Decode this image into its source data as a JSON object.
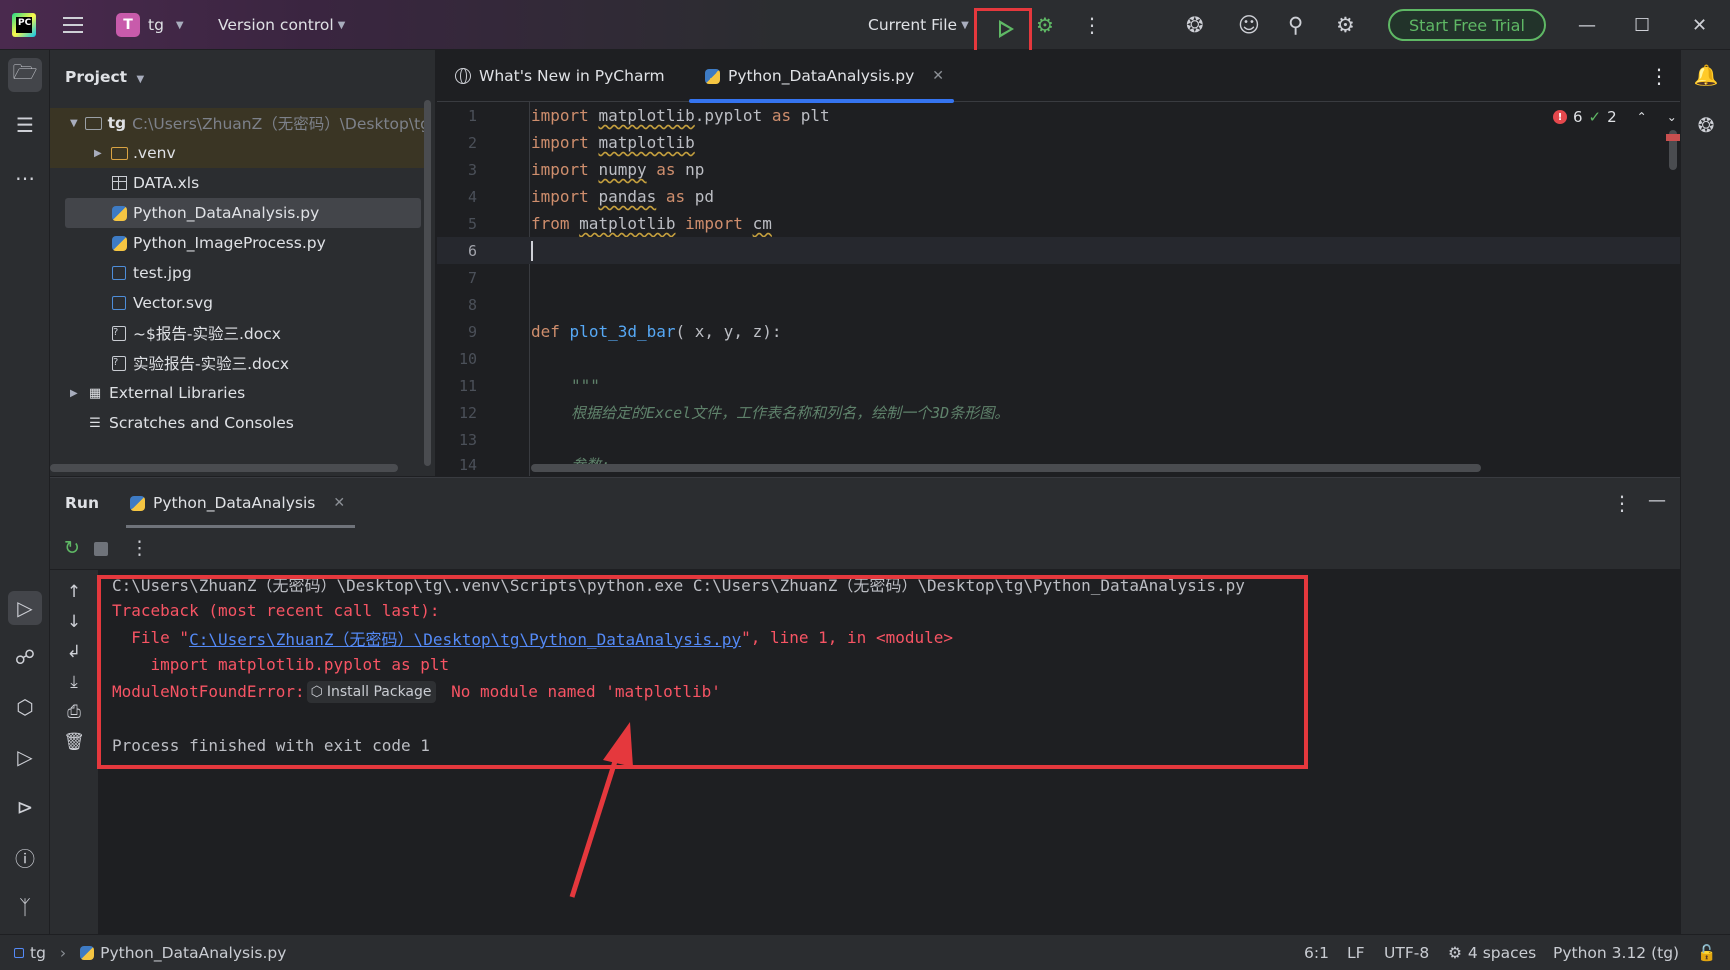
{
  "titlebar": {
    "project_initial": "T",
    "project_name": "tg",
    "version_control": "Version control",
    "run_config": "Current File",
    "trial_button": "Start Free Trial"
  },
  "project_panel": {
    "header": "Project",
    "root_name": "tg",
    "root_path": "C:\\Users\\ZhuanZ（无密码）\\Desktop\\tg",
    "items": [
      {
        "label": ".venv",
        "icon": "folder-icon"
      },
      {
        "label": "DATA.xls",
        "icon": "spreadsheet-icon"
      },
      {
        "label": "Python_DataAnalysis.py",
        "icon": "python-file-icon"
      },
      {
        "label": "Python_ImageProcess.py",
        "icon": "python-file-icon"
      },
      {
        "label": "test.jpg",
        "icon": "image-file-icon"
      },
      {
        "label": "Vector.svg",
        "icon": "image-file-icon"
      },
      {
        "label": "~$报告-实验三.docx",
        "icon": "unknown-file-icon"
      },
      {
        "label": "实验报告-实验三.docx",
        "icon": "unknown-file-icon"
      }
    ],
    "external_libraries": "External Libraries",
    "scratches": "Scratches and Consoles"
  },
  "editor": {
    "tabs": [
      {
        "label": "What's New in PyCharm"
      },
      {
        "label": "Python_DataAnalysis.py"
      }
    ],
    "error_count": "6",
    "ok_count": "2",
    "line_numbers": [
      "1",
      "2",
      "3",
      "4",
      "5",
      "6",
      "7",
      "8",
      "9",
      "10",
      "11",
      "12",
      "13",
      "14"
    ],
    "code": {
      "l1_kw": "import",
      "l1_mod": "matplotlib",
      "l1_rest": ".pyplot ",
      "l1_as": "as",
      "l1_alias": " plt",
      "l2_kw": "import",
      "l2_mod": "matplotlib",
      "l3_kw": "import",
      "l3_mod": "numpy",
      "l3_as": "as",
      "l3_alias": " np",
      "l4_kw": "import",
      "l4_mod": "pandas",
      "l4_as": "as",
      "l4_alias": " pd",
      "l5_from": "from",
      "l5_mod": "matplotlib",
      "l5_import": "import",
      "l5_name": "cm",
      "l9_def": "def",
      "l9_fn": "plot_3d_bar",
      "l9_args": "( x, y, z):",
      "l11_doc": "\"\"\"",
      "l12_doc": "根据给定的Excel文件，工作表名称和列名，绘制一个3D条形图。",
      "l14_doc": "参数:"
    }
  },
  "run_panel": {
    "title": "Run",
    "tab_label": "Python_DataAnalysis",
    "console": {
      "line1": "C:\\Users\\ZhuanZ（无密码）\\Desktop\\tg\\.venv\\Scripts\\python.exe C:\\Users\\ZhuanZ（无密码）\\Desktop\\tg\\Python_DataAnalysis.py",
      "line2": "Traceback (most recent call last):",
      "line3_pre": "  File \"",
      "line3_link": "C:\\Users\\ZhuanZ（无密码）\\Desktop\\tg\\Python_DataAnalysis.py",
      "line3_post": "\", line 1, in <module>",
      "line4": "    import matplotlib.pyplot as plt",
      "line5_pre": "ModuleNotFoundError:",
      "install_label": "Install Package",
      "line5_post": " No module named 'matplotlib'",
      "line7": "Process finished with exit code 1"
    }
  },
  "statusbar": {
    "crumb_project": "tg",
    "crumb_file": "Python_DataAnalysis.py",
    "position": "6:1",
    "line_sep": "LF",
    "encoding": "UTF-8",
    "indent": "4 spaces",
    "interpreter": "Python 3.12 (tg)"
  },
  "colors": {
    "accent": "#3574f0",
    "error": "#f75464",
    "run_green": "#5fb865",
    "annotation_red": "#e5383d"
  }
}
